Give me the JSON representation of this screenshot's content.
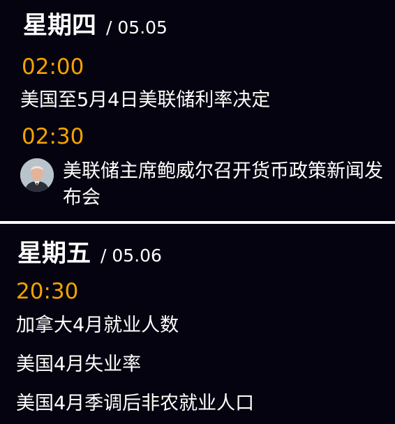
{
  "thursday": {
    "day": "星期四",
    "date": "/ 05.05",
    "events": [
      {
        "time": "02:00",
        "title": "美国至5月4日美联储利率决定"
      },
      {
        "time": "02:30",
        "title": "美联储主席鲍威尔召开货币政策新闻发布会",
        "avatar": "person-avatar"
      }
    ]
  },
  "friday": {
    "day": "星期五",
    "date": "/ 05.06",
    "time": "20:30",
    "events": [
      "加拿大4月就业人数",
      "美国4月失业率",
      "美国4月季调后非农就业人口"
    ]
  },
  "colors": {
    "background": "#05030f",
    "time_accent": "#f5a300",
    "text": "#ffffff",
    "divider": "#ffffff"
  }
}
